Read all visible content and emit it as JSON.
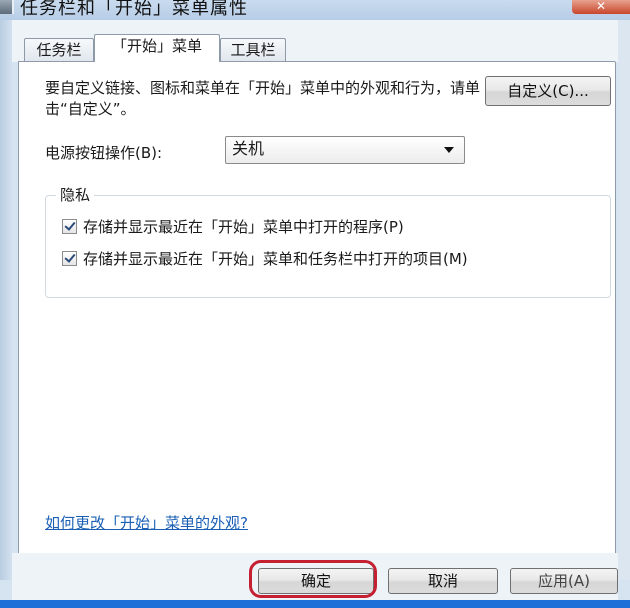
{
  "window": {
    "title": "任务栏和「开始」菜单属性"
  },
  "tabs": [
    {
      "label": "任务栏"
    },
    {
      "label": "「开始」菜单"
    },
    {
      "label": "工具栏"
    }
  ],
  "start_menu": {
    "description": "要自定义链接、图标和菜单在「开始」菜单中的外观和行为，请单击“自定义”。",
    "customize_label": "自定义(C)...",
    "power_button_label": "电源按钮操作(B):",
    "power_button_value": "关机",
    "privacy": {
      "title": "隐私",
      "items": [
        {
          "label": "存储并显示最近在「开始」菜单中打开的程序(P)",
          "checked": true
        },
        {
          "label": "存储并显示最近在「开始」菜单和任务栏中打开的项目(M)",
          "checked": true
        }
      ]
    },
    "help_link": "如何更改「开始」菜单的外观?"
  },
  "footer": {
    "ok_label": "确定",
    "cancel_label": "取消",
    "apply_label": "应用(A)"
  },
  "colors": {
    "highlight": "#c42032",
    "link": "#1a5fb4"
  }
}
